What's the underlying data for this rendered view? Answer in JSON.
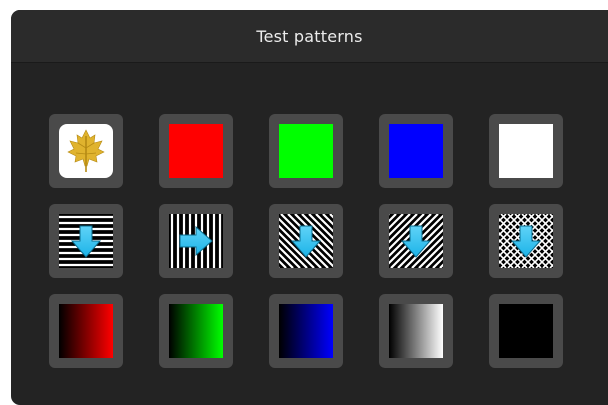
{
  "window": {
    "title": "Test patterns"
  },
  "tiles": [
    {
      "name": "logo-tile",
      "kind": "logo",
      "icon": "maple-leaf-icon"
    },
    {
      "name": "solid-red-tile",
      "kind": "solid",
      "color": "#ff0000"
    },
    {
      "name": "solid-green-tile",
      "kind": "solid",
      "color": "#00ff00"
    },
    {
      "name": "solid-blue-tile",
      "kind": "solid",
      "color": "#0000ff"
    },
    {
      "name": "solid-white-tile",
      "kind": "solid",
      "color": "#ffffff"
    },
    {
      "name": "horizontal-lines-tile",
      "kind": "lines",
      "pattern": "horizontal",
      "icon": "arrow-down-icon"
    },
    {
      "name": "vertical-lines-tile",
      "kind": "lines",
      "pattern": "vertical",
      "icon": "arrow-right-icon"
    },
    {
      "name": "diagonal-lines-left-tile",
      "kind": "lines",
      "pattern": "diagonal-left",
      "icon": "arrow-down-icon"
    },
    {
      "name": "diagonal-lines-right-tile",
      "kind": "lines",
      "pattern": "diagonal-right",
      "icon": "arrow-down-icon"
    },
    {
      "name": "crosshatch-tile",
      "kind": "lines",
      "pattern": "crosshatch",
      "icon": "arrow-down-icon"
    },
    {
      "name": "red-gradient-tile",
      "kind": "gradient",
      "from": "#000000",
      "to": "#ff0000"
    },
    {
      "name": "green-gradient-tile",
      "kind": "gradient",
      "from": "#000000",
      "to": "#00ff00"
    },
    {
      "name": "blue-gradient-tile",
      "kind": "gradient",
      "from": "#000000",
      "to": "#0000ff"
    },
    {
      "name": "gray-gradient-tile",
      "kind": "gradient",
      "from": "#000000",
      "to": "#ffffff"
    },
    {
      "name": "solid-black-tile",
      "kind": "solid",
      "color": "#000000"
    }
  ],
  "colors": {
    "window_bg": "#232323",
    "titlebar_bg": "#2b2b2b",
    "tile_bg": "#4a4a4a",
    "arrow_color": "#1cb3e8",
    "logo_gold": "#e0b32e"
  }
}
